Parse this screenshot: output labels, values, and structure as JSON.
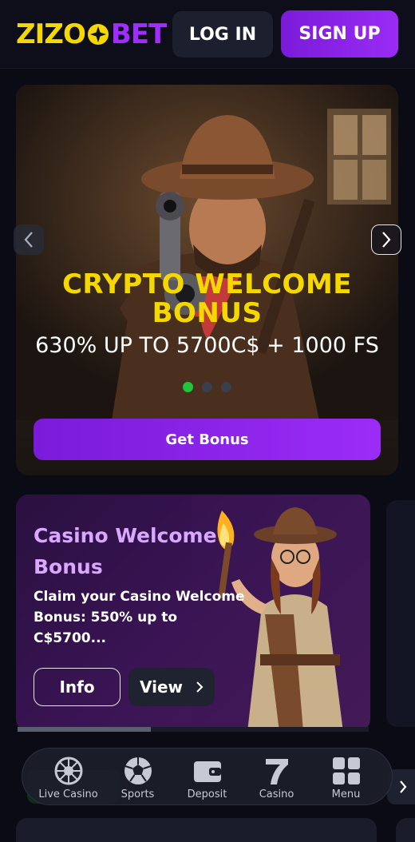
{
  "header": {
    "logo": {
      "part1": "ZIZO",
      "part2": "BET",
      "yellow": "#f5d800",
      "purple": "#a12cff"
    },
    "login_label": "LOG IN",
    "signup_label": "SIGN UP"
  },
  "hero": {
    "title": "CRYPTO WELCOME BONUS",
    "subtitle": "630% UP TO 5700C$ + 1000 FS",
    "cta": "Get Bonus",
    "slides": 3,
    "active_slide": 1,
    "prev_icon": "chevron-left-icon",
    "next_icon": "chevron-right-icon"
  },
  "promo": {
    "title": "Casino Welcome Bonus",
    "description": "Claim your Casino Welcome Bonus: 550% up to C$5700...",
    "info_label": "Info",
    "view_label": "View",
    "carousel_progress": 0.38
  },
  "bottom_nav": {
    "items": [
      {
        "label": "Live Casino",
        "icon": "roulette-icon"
      },
      {
        "label": "Sports",
        "icon": "soccer-ball-icon"
      },
      {
        "label": "Deposit",
        "icon": "wallet-icon"
      },
      {
        "label": "Casino",
        "icon": "seven-icon"
      },
      {
        "label": "Menu",
        "icon": "grid-menu-icon"
      }
    ]
  },
  "colors": {
    "accent_purple": "#8a22ee",
    "accent_yellow": "#f5d800",
    "active_green": "#1ec63a",
    "background": "#0b0b16"
  }
}
